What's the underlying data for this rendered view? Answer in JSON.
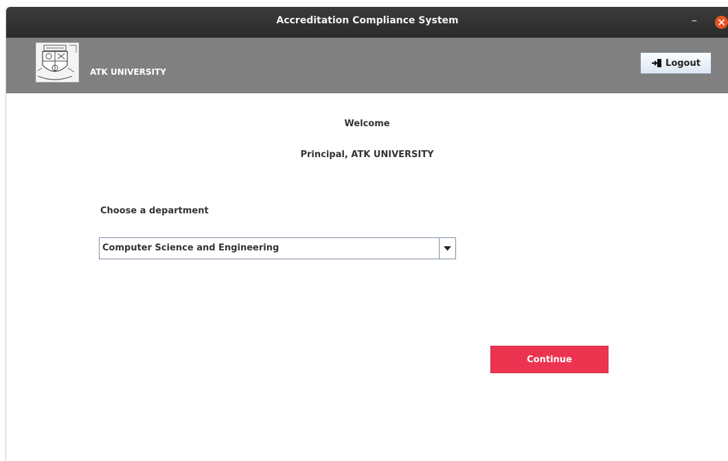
{
  "window": {
    "title": "Accreditation Compliance System",
    "minimize_symbol": "–",
    "close_icon": "close-icon"
  },
  "header": {
    "university_name": "ATK UNIVERSITY",
    "logo_icon": "university-crest-icon",
    "logout_label": "Logout",
    "logout_icon": "logout-door-icon"
  },
  "main": {
    "welcome_text": "Welcome",
    "principal_text": "Principal, ATK UNIVERSITY",
    "choose_label": "Choose a department",
    "department_selected": "Computer Science and Engineering",
    "continue_label": "Continue"
  },
  "colors": {
    "titlebar": "#2f2f2f",
    "header": "#808080",
    "close": "#e95420",
    "continue": "#ec3450"
  }
}
